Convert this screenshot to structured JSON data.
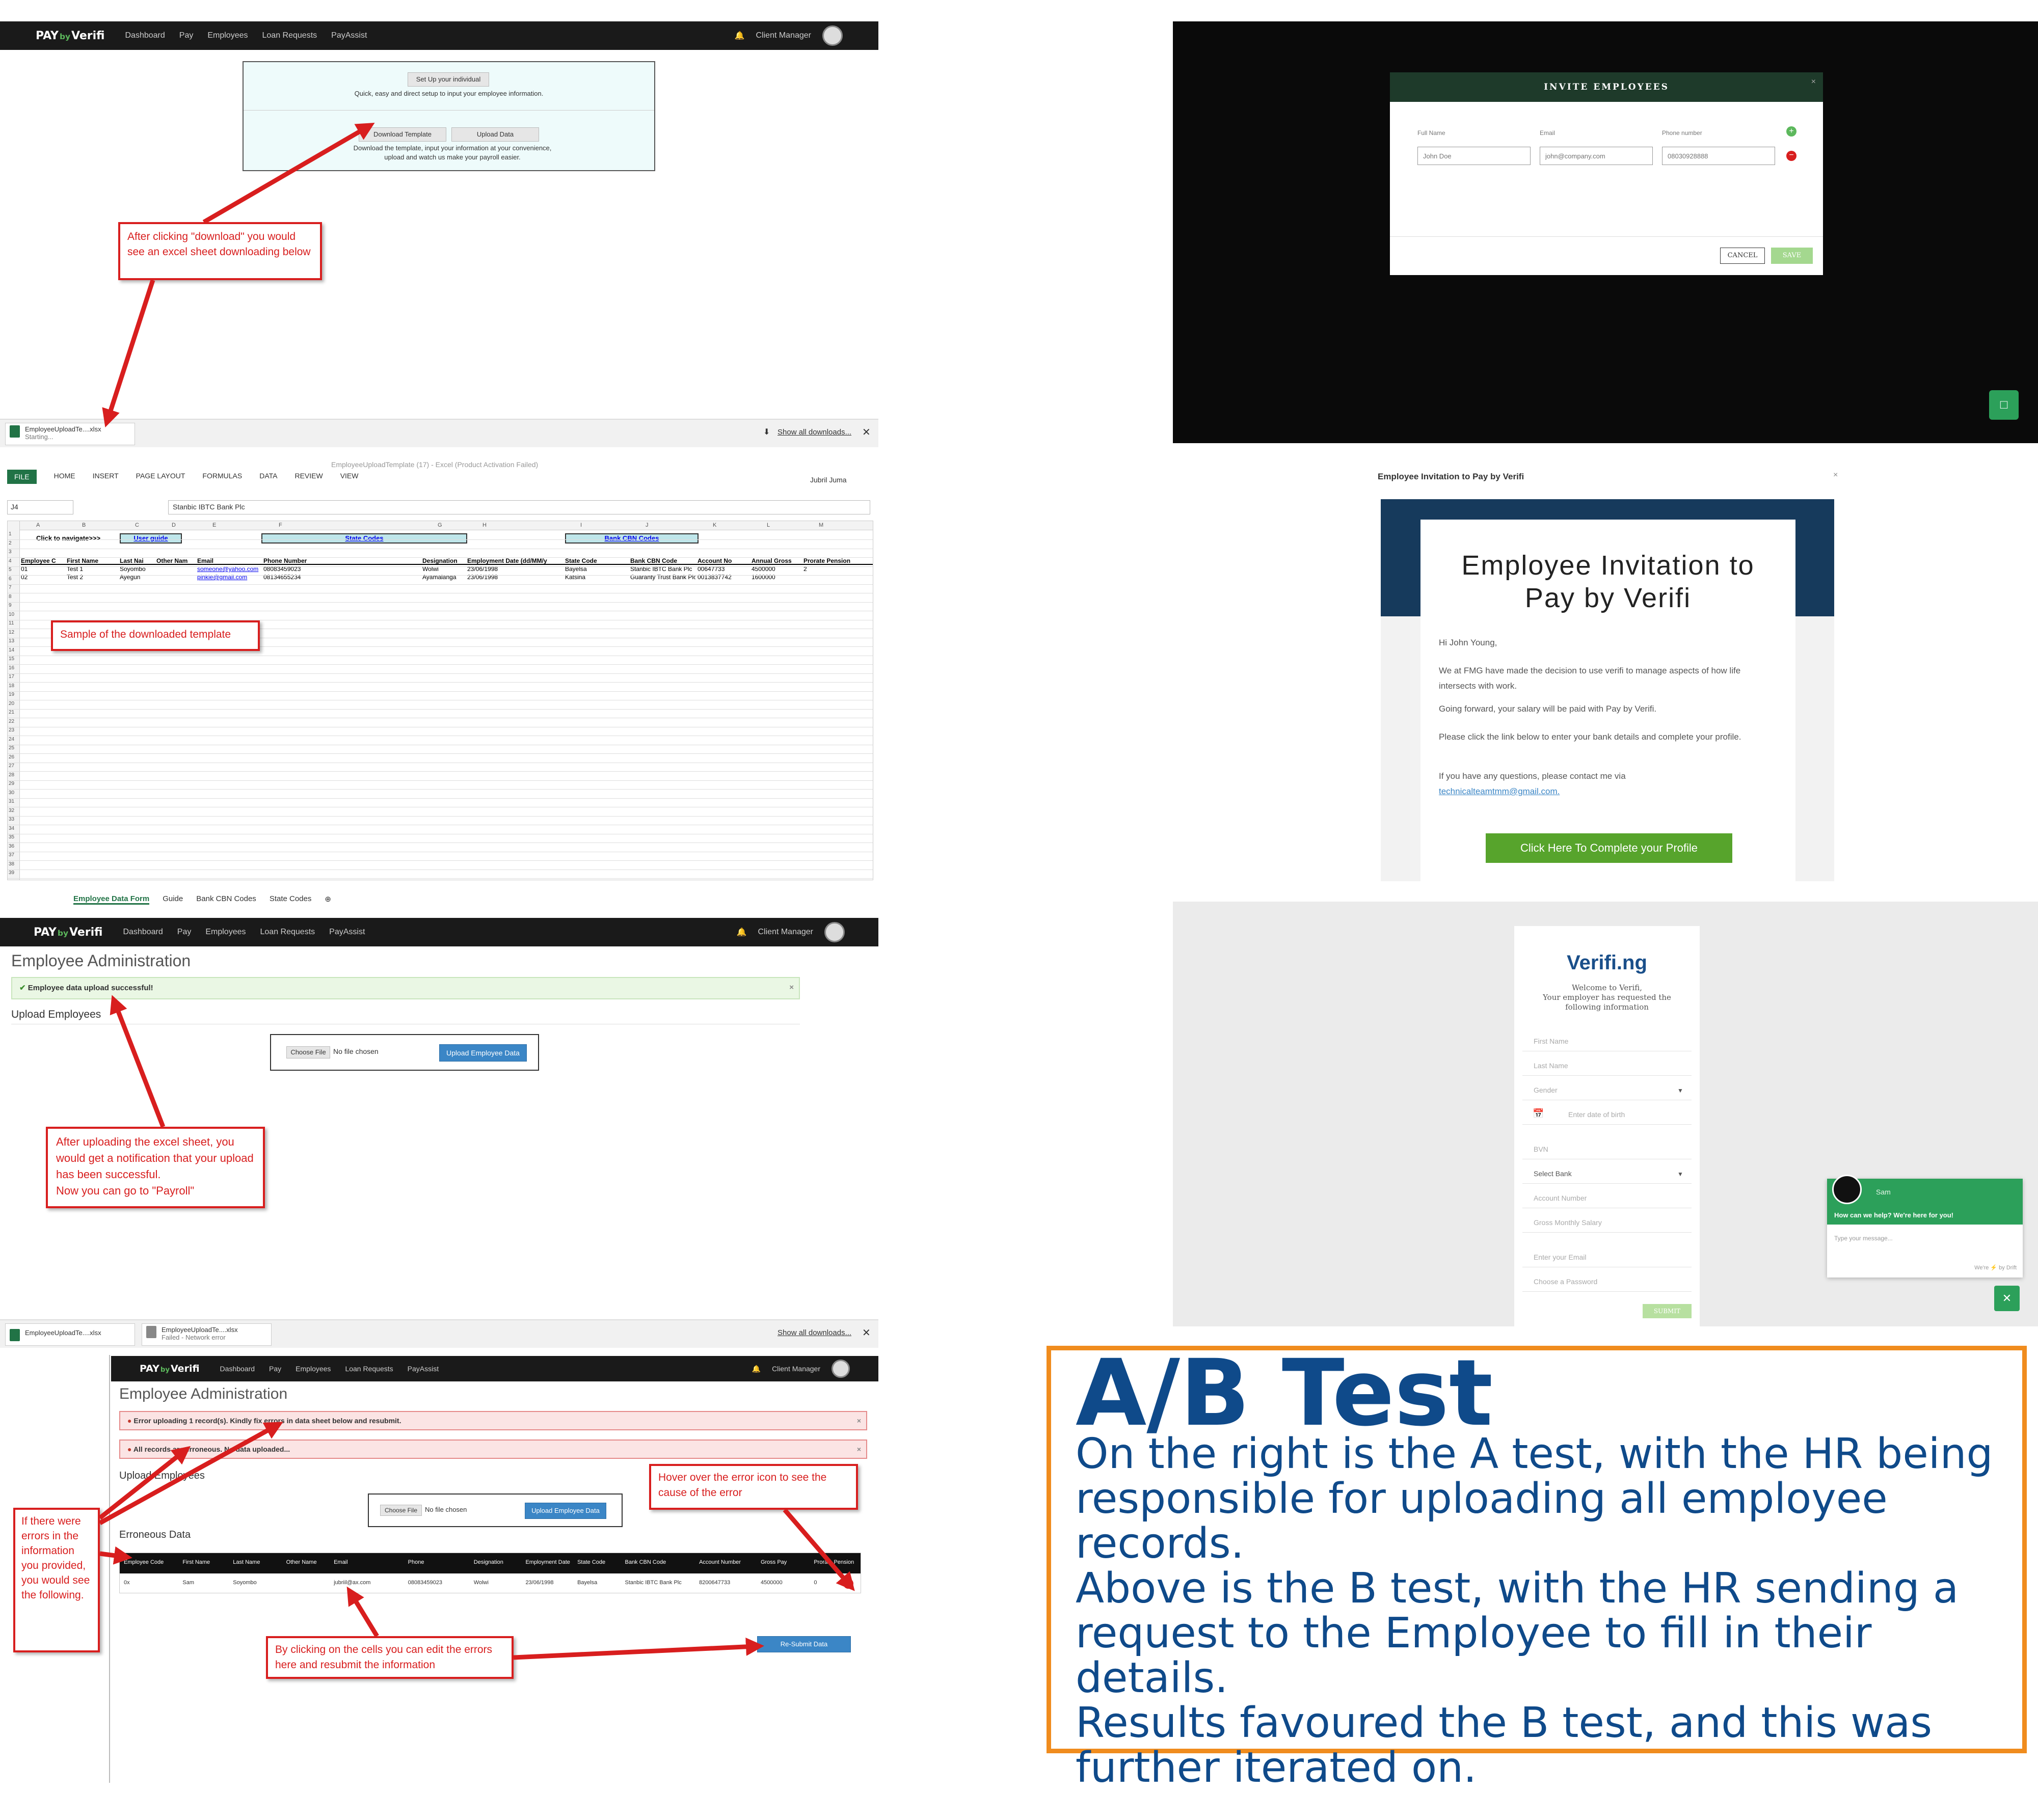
{
  "colors": {
    "nav": "#1a1a1a",
    "accent_red": "#d81e1e",
    "accent_green": "#5cb85c",
    "blue_button": "#3b86c6",
    "ab_border": "#f08c1e",
    "ab_text": "#0f4a8a",
    "invite_header": "#1e3a2a",
    "email_banner": "#163a5c",
    "cta_green": "#57a42c",
    "chat_green": "#2ca05a"
  },
  "nav": {
    "logo_pre": "PAY",
    "logo_by": "by",
    "logo_post": "Verifi",
    "items": [
      "Dashboard",
      "Pay",
      "Employees",
      "Loan Requests",
      "PayAssist"
    ],
    "role": "Client Manager"
  },
  "setup": {
    "title": "Set Up your individual",
    "subtitle": "Quick, easy and direct setup to input your employee information.",
    "download_btn": "Download Template",
    "upload_btn": "Upload Data",
    "desc": "Download the template, input your information at your convenience, upload and watch us make your payroll easier."
  },
  "callouts": {
    "download": "After clicking \"download\" you would see an excel sheet downloading below",
    "sample": "Sample of the downloaded template",
    "after_upload": "After uploading the excel sheet, you would get a notification that your upload has been successful.\nNow you can go to \"Payroll\"",
    "errors": "If there were errors in the information you provided, you would see the following.",
    "hover": "Hover over the error icon to see the cause of the error",
    "edit": "By clicking on the cells you can edit the errors here and resubmit the information"
  },
  "downloads": {
    "file1": "EmployeeUploadTe....xlsx",
    "status1": "Starting...",
    "show_all": "Show all downloads...",
    "file2": "EmployeeUploadTe....xlsx",
    "file3": "EmployeeUploadTe....xlsx",
    "status3": "Failed - Network error"
  },
  "excel": {
    "title": "EmployeeUploadTemplate (17) - Excel (Product Activation Failed)",
    "user": "Jubril Juma",
    "ribbon": [
      "FILE",
      "HOME",
      "INSERT",
      "PAGE LAYOUT",
      "FORMULAS",
      "DATA",
      "REVIEW",
      "VIEW"
    ],
    "namebox": "J4",
    "formula": "Stanbic IBTC Bank Plc",
    "cols": [
      "A",
      "B",
      "C",
      "D",
      "E",
      "F",
      "G",
      "H",
      "I",
      "J",
      "K",
      "L",
      "M",
      "N"
    ],
    "nav_label": "Click to navigate>>>",
    "links": [
      "User guide",
      "State Codes",
      "Bank CBN Codes"
    ],
    "headers": [
      "Employee C",
      "First Name",
      "Last Nai",
      "Other Nam",
      "Email",
      "Phone Number",
      "Designation",
      "Employment Date (dd/MM/y",
      "State Code",
      "Bank CBN Code",
      "Account No",
      "Annual Gross",
      "Prorate Pension"
    ],
    "rows": [
      [
        "01",
        "Test 1",
        "Soyombo",
        "",
        "someone@yahoo.com",
        "08083459023",
        "Wolwi",
        "23/06/1998",
        "Bayelsa",
        "Stanbic IBTC Bank Plc",
        "00647733",
        "4500000",
        "2"
      ],
      [
        "02",
        "Test 2",
        "Ayegun",
        "",
        "pinkie@gmail.com",
        "08134655234",
        "Ayamalanga",
        "23/06/1998",
        "Katsina",
        "Guaranty Trust Bank Plc",
        "0013837742",
        "1600000",
        ""
      ]
    ],
    "sheets": [
      "Employee Data Form",
      "Guide",
      "Bank CBN Codes",
      "State Codes"
    ]
  },
  "admin": {
    "title": "Employee Administration",
    "success": "Employee data upload successful!",
    "upload_heading": "Upload Employees",
    "choose_file": "Choose File",
    "no_file": "No file chosen",
    "upload_btn": "Upload Employee Data"
  },
  "admin2": {
    "title": "Employee Administration",
    "error1": "Error uploading 1 record(s). Kindly fix errors in data sheet below and resubmit.",
    "error2": "All records are erroneous. No data uploaded...",
    "upload_heading": "Upload Employees",
    "erroneous": "Erroneous Data",
    "table_headers": [
      "Employee Code",
      "First Name",
      "Last Name",
      "Other Name",
      "Email",
      "Phone",
      "Designation",
      "Employment Date",
      "State Code",
      "Bank CBN Code",
      "Account Number",
      "Gross Pay",
      "Prorate Pension"
    ],
    "table_row": [
      "0x",
      "Sam",
      "Soyombo",
      "",
      "jubriil@ax.com",
      "08083459023",
      "Wolwi",
      "23/06/1998",
      "Bayelsa",
      "Stanbic IBTC Bank Plc",
      "8200647733",
      "4500000",
      "0"
    ],
    "resubmit": "Re-Submit Data"
  },
  "invite": {
    "title": "INVITE EMPLOYEES",
    "labels": [
      "Full Name",
      "Email",
      "Phone number"
    ],
    "placeholders": [
      "John Doe",
      "john@company.com",
      "08030928888"
    ],
    "cancel": "CANCEL",
    "save": "SAVE"
  },
  "email": {
    "window_title": "Employee Invitation to Pay by Verifi",
    "heading": "Employee Invitation to Pay by Verifi",
    "greeting": "Hi John Young,",
    "p1": "We at FMG have made the decision to use verifi to manage aspects of how life intersects with work.",
    "p2": "Going forward, your salary will be paid with Pay by Verifi.",
    "p3": "Please click the link below to enter your bank details and complete your profile.",
    "p4": "If you have any questions, please contact me via",
    "email_link": "technicalteamtmm@gmail.com.",
    "cta": "Click Here To Complete your Profile"
  },
  "form": {
    "logo": "Verifi.ng",
    "intro": "Welcome to Verifi,\nYour employer has requested the following information",
    "fields": [
      "First Name",
      "Last Name",
      "Gender",
      "Enter date of birth",
      "BVN",
      "Select Bank",
      "Account Number",
      "Gross Monthly Salary",
      "Enter your Email",
      "Choose a Password"
    ],
    "submit": "SUBMIT"
  },
  "chat": {
    "name": "Sam",
    "prompt": "How can we help? We're here for you!",
    "input": "Type your message...",
    "footer": "We're ⚡ by Drift"
  },
  "ab": {
    "title": "A/B Test",
    "body": "On the right is the A test, with the HR being responsible for uploading all employee records.\nAbove is the B test, with the HR sending a request to the Employee to fill in their details.\nResults favoured the B test, and this was further iterated on."
  }
}
